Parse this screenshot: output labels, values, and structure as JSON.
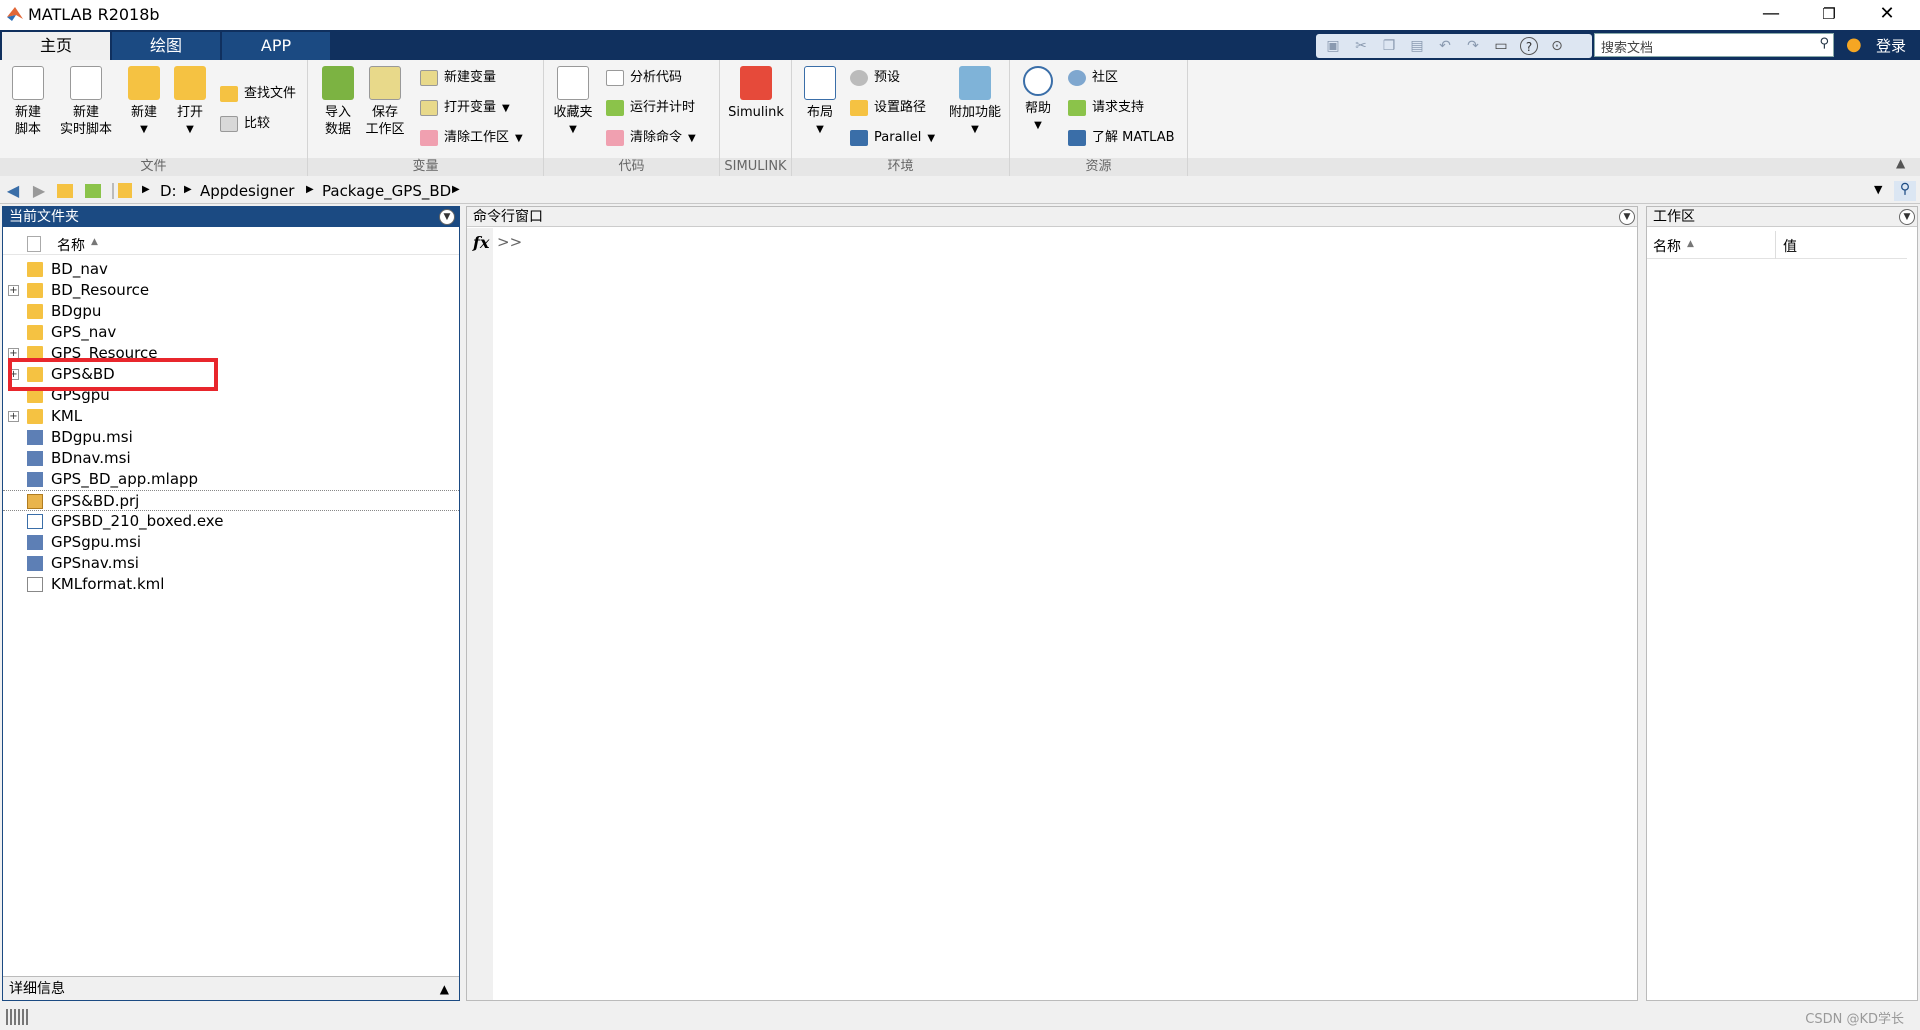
{
  "window": {
    "title": "MATLAB R2018b",
    "minimize": "—",
    "restore": "❐",
    "close": "✕"
  },
  "tabs": [
    {
      "label": "主页"
    },
    {
      "label": "绘图"
    },
    {
      "label": "APP"
    }
  ],
  "search": {
    "placeholder": "搜索文档"
  },
  "login": "登录",
  "ribbon": {
    "file": {
      "label": "文件",
      "new_script": [
        "新建",
        "脚本"
      ],
      "new_live": [
        "新建",
        "实时脚本"
      ],
      "new": "新建",
      "open": "打开",
      "find_files": "查找文件",
      "compare": "比较"
    },
    "variable": {
      "label": "变量",
      "import": [
        "导入",
        "数据"
      ],
      "save_ws": [
        "保存",
        "工作区"
      ],
      "new_var": "新建变量",
      "open_var": "打开变量",
      "clear_ws": "清除工作区"
    },
    "code": {
      "label": "代码",
      "favorites": "收藏夹",
      "analyze": "分析代码",
      "run_time": "运行并计时",
      "clear_cmds": "清除命令"
    },
    "simulink": {
      "label": "SIMULINK",
      "simulink": "Simulink"
    },
    "env": {
      "label": "环境",
      "layout": "布局",
      "prefs": "预设",
      "set_path": "设置路径",
      "parallel": "Parallel",
      "addons": "附加功能"
    },
    "resources": {
      "label": "资源",
      "help": "帮助",
      "community": "社区",
      "support": "请求支持",
      "learn": "了解 MATLAB"
    }
  },
  "address": {
    "path": [
      "D:",
      "Appdesigner",
      "Package_GPS_BD"
    ]
  },
  "current_folder": {
    "title": "当前文件夹",
    "col_name": "名称",
    "items": [
      {
        "name": "BD_nav",
        "type": "folder",
        "expandable": false
      },
      {
        "name": "BD_Resource",
        "type": "folder",
        "expandable": true
      },
      {
        "name": "BDgpu",
        "type": "folder",
        "expandable": false
      },
      {
        "name": "GPS_nav",
        "type": "folder",
        "expandable": false
      },
      {
        "name": "GPS_Resource",
        "type": "folder",
        "expandable": true
      },
      {
        "name": "GPS&BD",
        "type": "folder",
        "expandable": true
      },
      {
        "name": "GPSgpu",
        "type": "folder",
        "expandable": false
      },
      {
        "name": "KML",
        "type": "folder",
        "expandable": true
      },
      {
        "name": "BDgpu.msi",
        "type": "msi",
        "expandable": false
      },
      {
        "name": "BDnav.msi",
        "type": "msi",
        "expandable": false
      },
      {
        "name": "GPS_BD_app.mlapp",
        "type": "msi",
        "expandable": false
      },
      {
        "name": "GPS&BD.prj",
        "type": "prj",
        "expandable": false
      },
      {
        "name": "GPSBD_210_boxed.exe",
        "type": "exe",
        "expandable": false
      },
      {
        "name": "GPSgpu.msi",
        "type": "msi",
        "expandable": false
      },
      {
        "name": "GPSnav.msi",
        "type": "msi",
        "expandable": false
      },
      {
        "name": "KMLformat.kml",
        "type": "doc",
        "expandable": false
      }
    ],
    "details": "详细信息"
  },
  "command_window": {
    "title": "命令行窗口",
    "fx": "fx",
    "prompt": ">>"
  },
  "workspace": {
    "title": "工作区",
    "col_name": "名称",
    "col_value": "值"
  },
  "watermark": "CSDN @KD学长"
}
